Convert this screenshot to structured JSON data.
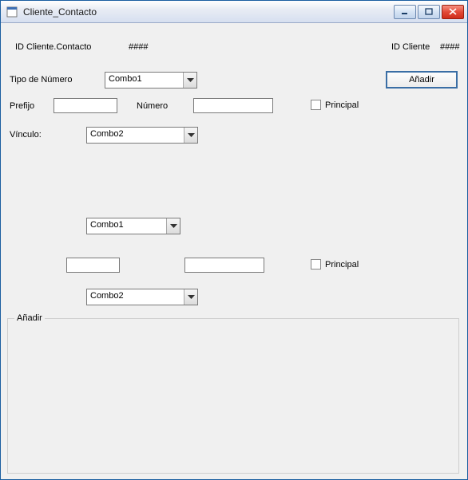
{
  "window": {
    "title": "Cliente_Contacto"
  },
  "header": {
    "id_contacto_label": "ID Cliente.Contacto",
    "id_contacto_value": "####",
    "id_cliente_label": "ID Cliente",
    "id_cliente_value": "####"
  },
  "section1": {
    "tipo_numero_label": "Tipo de Número",
    "tipo_numero_value": "Combo1",
    "prefijo_label": "Prefijo",
    "prefijo_value": "",
    "numero_label": "Número",
    "numero_value": "",
    "principal_label": "Principal",
    "vinculo_label": "Vínculo:",
    "vinculo_value": "Combo2",
    "add_button": "Añadir"
  },
  "section2": {
    "tipo_numero_value": "Combo1",
    "prefijo_value": "",
    "numero_value": "",
    "principal_label": "Principal",
    "vinculo_value": "Combo2"
  },
  "groupbox": {
    "title": "Añadir"
  }
}
